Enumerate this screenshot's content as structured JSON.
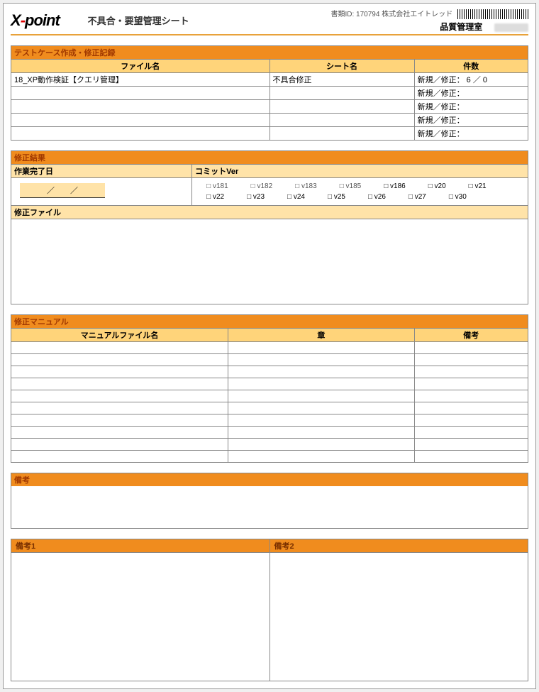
{
  "header": {
    "logo_x": "X",
    "logo_dash": "-",
    "logo_point": "point",
    "title": "不具合・要望管理シート",
    "doc_id_label": "書類ID:",
    "doc_id": "170794",
    "company": "株式会社エイトレッド",
    "dept": "品質管理室"
  },
  "section1": {
    "title": "テストケース作成・修正記録",
    "col_file": "ファイル名",
    "col_sheet": "シート名",
    "col_count": "件数",
    "count_label": "新規／修正：",
    "rows": [
      {
        "file": "18_XP動作検証【クエリ管理】",
        "sheet": "不具合修正",
        "new": "6",
        "sep": "／",
        "fix": "0"
      },
      {
        "file": "",
        "sheet": "",
        "new": "",
        "sep": "",
        "fix": ""
      },
      {
        "file": "",
        "sheet": "",
        "new": "",
        "sep": "",
        "fix": ""
      },
      {
        "file": "",
        "sheet": "",
        "new": "",
        "sep": "",
        "fix": ""
      },
      {
        "file": "",
        "sheet": "",
        "new": "",
        "sep": "",
        "fix": ""
      }
    ]
  },
  "section2": {
    "title": "修正結果",
    "work_done_label": "作業完了日",
    "date_value": "／　　／",
    "commit_label": "コミットVer",
    "versions_row1": [
      {
        "label": "v181",
        "on": false
      },
      {
        "label": "v182",
        "on": false
      },
      {
        "label": "v183",
        "on": false
      },
      {
        "label": "v185",
        "on": false
      },
      {
        "label": "v186",
        "on": true
      },
      {
        "label": "v20",
        "on": true
      },
      {
        "label": "v21",
        "on": true
      }
    ],
    "versions_row2": [
      {
        "label": "v22",
        "on": true
      },
      {
        "label": "v23",
        "on": true
      },
      {
        "label": "v24",
        "on": true
      },
      {
        "label": "v25",
        "on": true
      },
      {
        "label": "v26",
        "on": true
      },
      {
        "label": "v27",
        "on": true
      },
      {
        "label": "v30",
        "on": true
      }
    ],
    "fix_file_label": "修正ファイル"
  },
  "section3": {
    "title": "修正マニュアル",
    "col_manual": "マニュアルファイル名",
    "col_chapter": "章",
    "col_remark": "備考",
    "row_count": 10
  },
  "section4": {
    "title": "備考"
  },
  "section5": {
    "col1": "備考1",
    "col2": "備考2"
  }
}
